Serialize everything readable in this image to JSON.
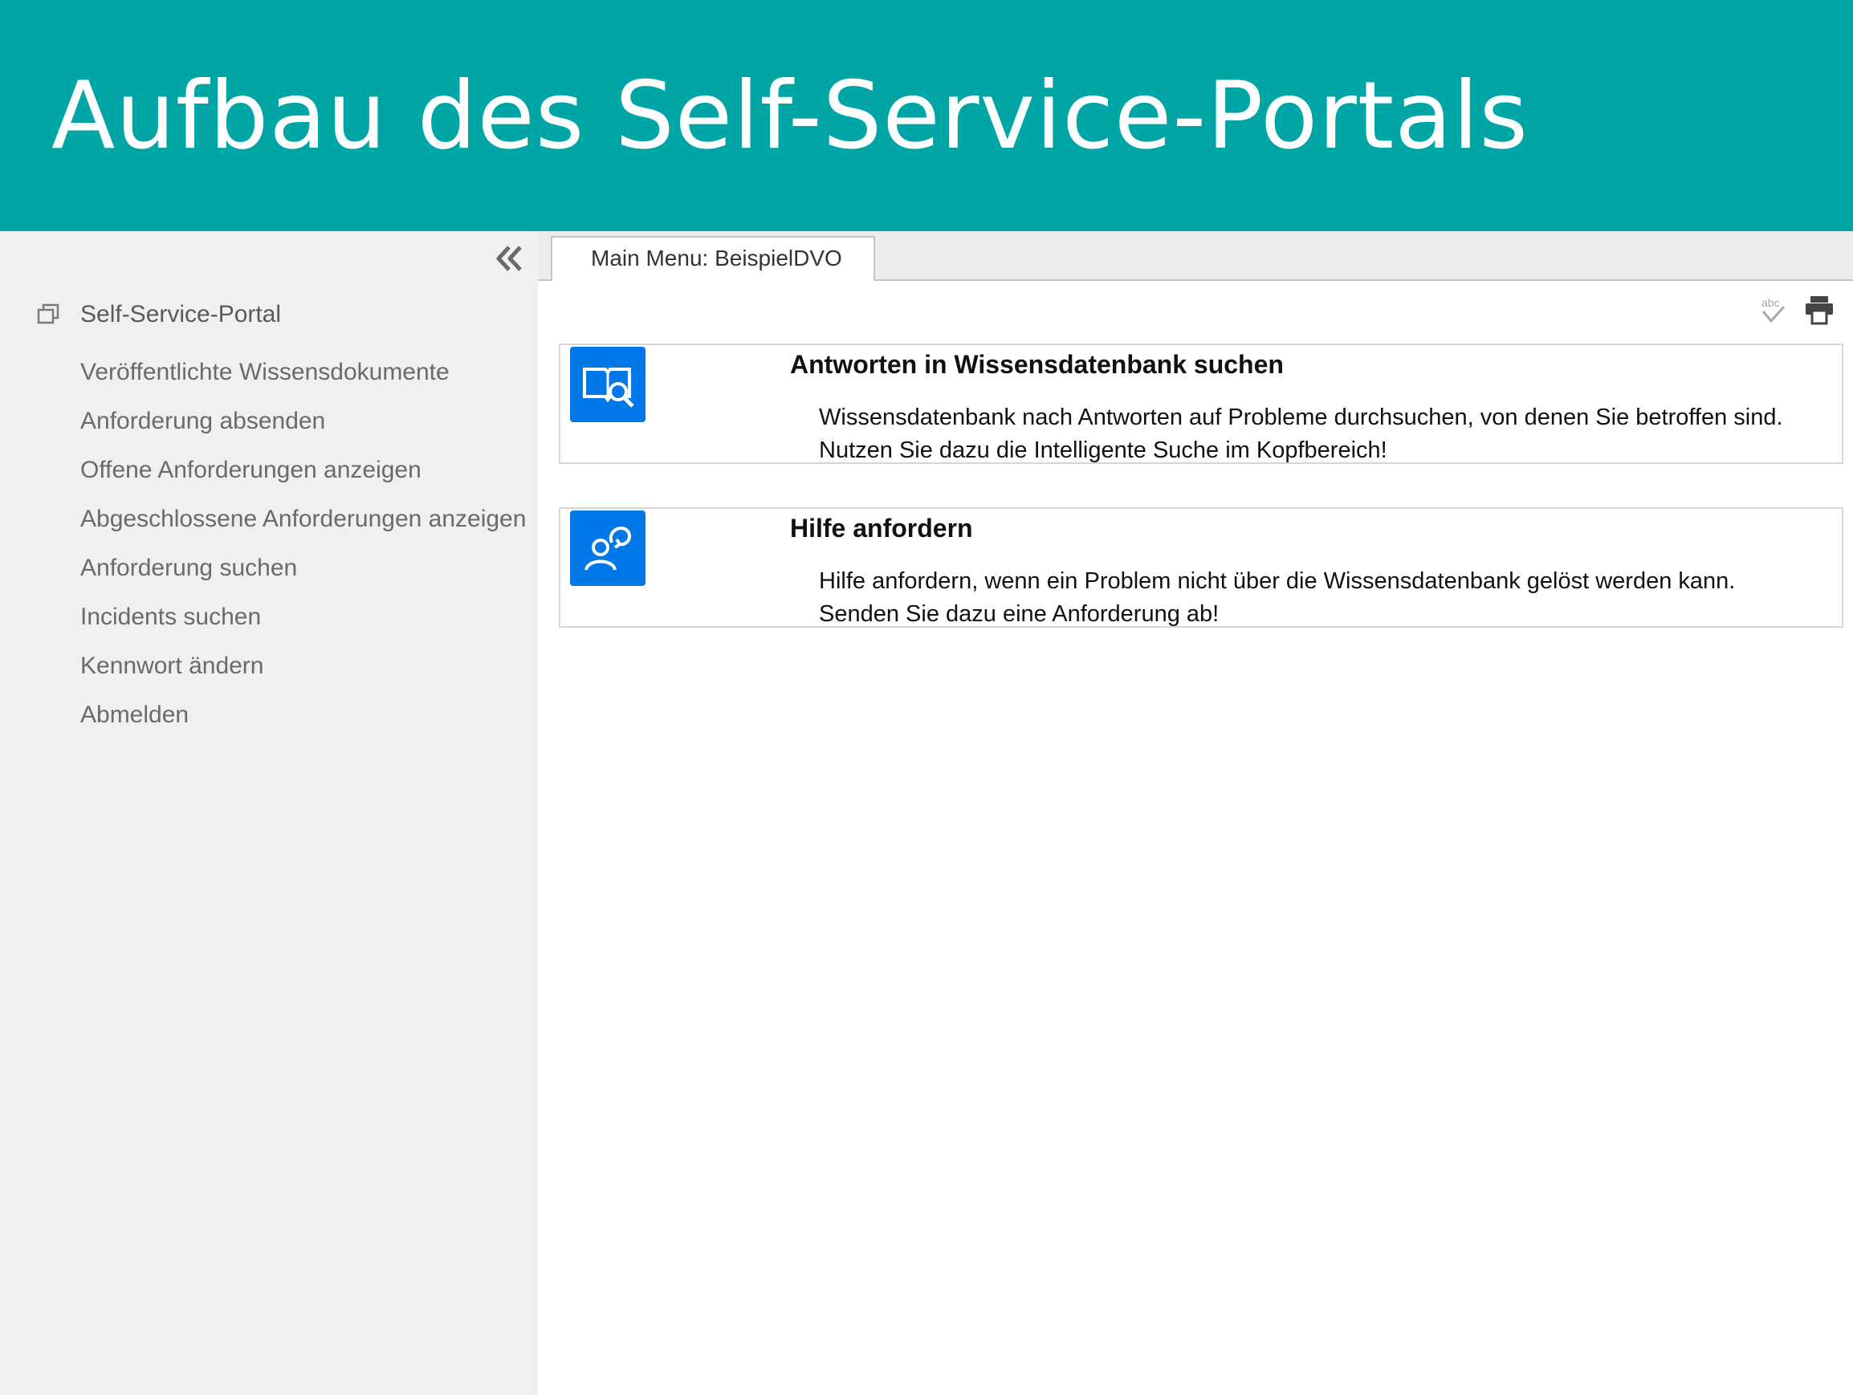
{
  "header": {
    "title": "Aufbau des Self-Service-Portals"
  },
  "colors": {
    "header_bg": "#00a5a5",
    "tile_blue": "#0078e7",
    "sidebar_bg": "#f0f0f0"
  },
  "sidebar": {
    "collapse_icon": "double-chevron-left-icon",
    "root": {
      "icon": "windows-stack-icon",
      "label": "Self-Service-Portal"
    },
    "items": [
      {
        "label": "Veröffentlichte Wissensdokumente"
      },
      {
        "label": "Anforderung absenden"
      },
      {
        "label": "Offene Anforderungen anzeigen"
      },
      {
        "label": "Abgeschlossene Anforderungen anzeigen"
      },
      {
        "label": "Anforderung suchen"
      },
      {
        "label": "Incidents suchen"
      },
      {
        "label": "Kennwort ändern"
      },
      {
        "label": "Abmelden"
      }
    ]
  },
  "tabs": [
    {
      "label": "Main Menu: BeispielDVO",
      "active": true
    }
  ],
  "toolbar": {
    "spellcheck_icon": "spellcheck-icon",
    "print_icon": "printer-icon"
  },
  "cards": [
    {
      "icon": "book-search-icon",
      "title": "Antworten in Wissensdatenbank suchen",
      "description": "Wissensdatenbank nach Antworten auf Probleme durchsuchen, von denen Sie betroffen sind. Nutzen Sie dazu die Intelligente Suche im Kopfbereich!"
    },
    {
      "icon": "person-help-icon",
      "title": "Hilfe anfordern",
      "description": "Hilfe anfordern, wenn ein Problem nicht über die Wissensdatenbank gelöst werden kann. Senden Sie dazu eine Anforderung ab!"
    }
  ]
}
